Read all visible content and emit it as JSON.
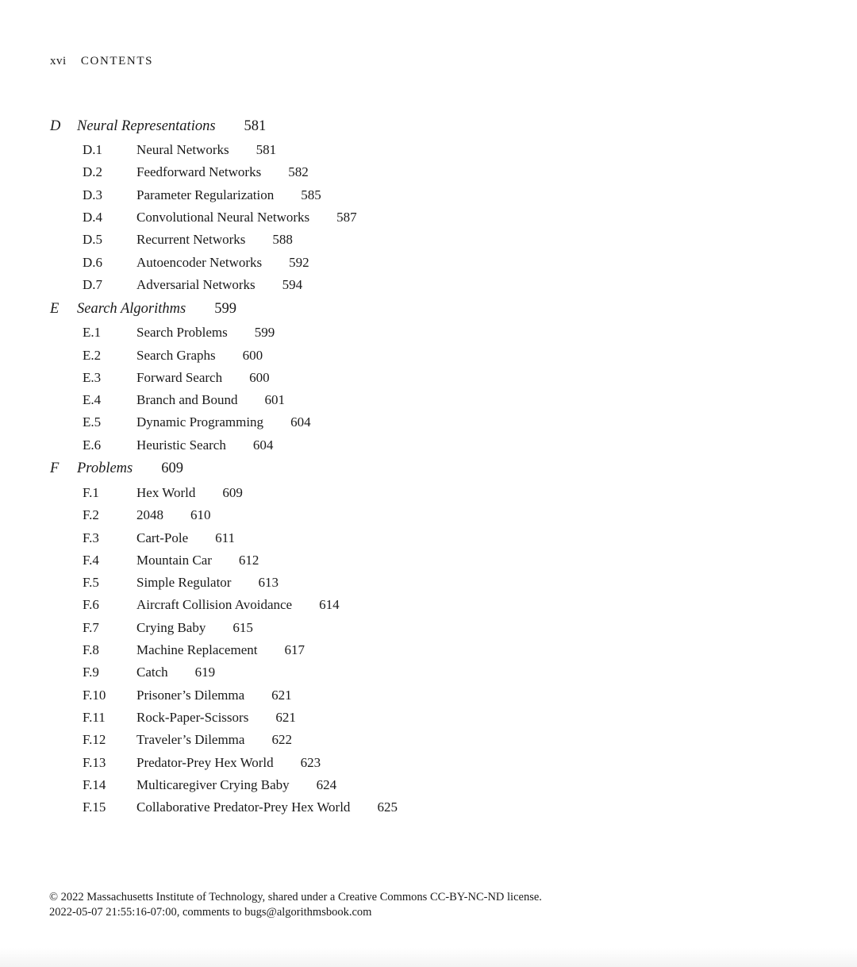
{
  "running_head": {
    "page_number": "xvi",
    "title": "CONTENTS"
  },
  "chapters": [
    {
      "letter": "D",
      "title": "Neural Representations",
      "page": "581",
      "sections": [
        {
          "num": "D.1",
          "title": "Neural Networks",
          "page": "581"
        },
        {
          "num": "D.2",
          "title": "Feedforward Networks",
          "page": "582"
        },
        {
          "num": "D.3",
          "title": "Parameter Regularization",
          "page": "585"
        },
        {
          "num": "D.4",
          "title": "Convolutional Neural Networks",
          "page": "587"
        },
        {
          "num": "D.5",
          "title": "Recurrent Networks",
          "page": "588"
        },
        {
          "num": "D.6",
          "title": "Autoencoder Networks",
          "page": "592"
        },
        {
          "num": "D.7",
          "title": "Adversarial Networks",
          "page": "594"
        }
      ]
    },
    {
      "letter": "E",
      "title": "Search Algorithms",
      "page": "599",
      "sections": [
        {
          "num": "E.1",
          "title": "Search Problems",
          "page": "599"
        },
        {
          "num": "E.2",
          "title": "Search Graphs",
          "page": "600"
        },
        {
          "num": "E.3",
          "title": "Forward Search",
          "page": "600"
        },
        {
          "num": "E.4",
          "title": "Branch and Bound",
          "page": "601"
        },
        {
          "num": "E.5",
          "title": "Dynamic Programming",
          "page": "604"
        },
        {
          "num": "E.6",
          "title": "Heuristic Search",
          "page": "604"
        }
      ]
    },
    {
      "letter": "F",
      "title": "Problems",
      "page": "609",
      "sections": [
        {
          "num": "F.1",
          "title": "Hex World",
          "page": "609"
        },
        {
          "num": "F.2",
          "title": "2048",
          "page": "610"
        },
        {
          "num": "F.3",
          "title": "Cart-Pole",
          "page": "611"
        },
        {
          "num": "F.4",
          "title": "Mountain Car",
          "page": "612"
        },
        {
          "num": "F.5",
          "title": "Simple Regulator",
          "page": "613"
        },
        {
          "num": "F.6",
          "title": "Aircraft Collision Avoidance",
          "page": "614"
        },
        {
          "num": "F.7",
          "title": "Crying Baby",
          "page": "615"
        },
        {
          "num": "F.8",
          "title": "Machine Replacement",
          "page": "617"
        },
        {
          "num": "F.9",
          "title": "Catch",
          "page": "619"
        },
        {
          "num": "F.10",
          "title": "Prisoner’s Dilemma",
          "page": "621"
        },
        {
          "num": "F.11",
          "title": "Rock-Paper-Scissors",
          "page": "621"
        },
        {
          "num": "F.12",
          "title": "Traveler’s Dilemma",
          "page": "622"
        },
        {
          "num": "F.13",
          "title": "Predator-Prey Hex World",
          "page": "623"
        },
        {
          "num": "F.14",
          "title": "Multicaregiver Crying Baby",
          "page": "624"
        },
        {
          "num": "F.15",
          "title": "Collaborative Predator-Prey Hex World",
          "page": "625"
        }
      ]
    }
  ],
  "footer": {
    "line1": "© 2022 Massachusetts Institute of Technology, shared under a Creative Commons CC-BY-NC-ND license.",
    "line2": "2022-05-07 21:55:16-07:00, comments to bugs@algorithmsbook.com"
  }
}
